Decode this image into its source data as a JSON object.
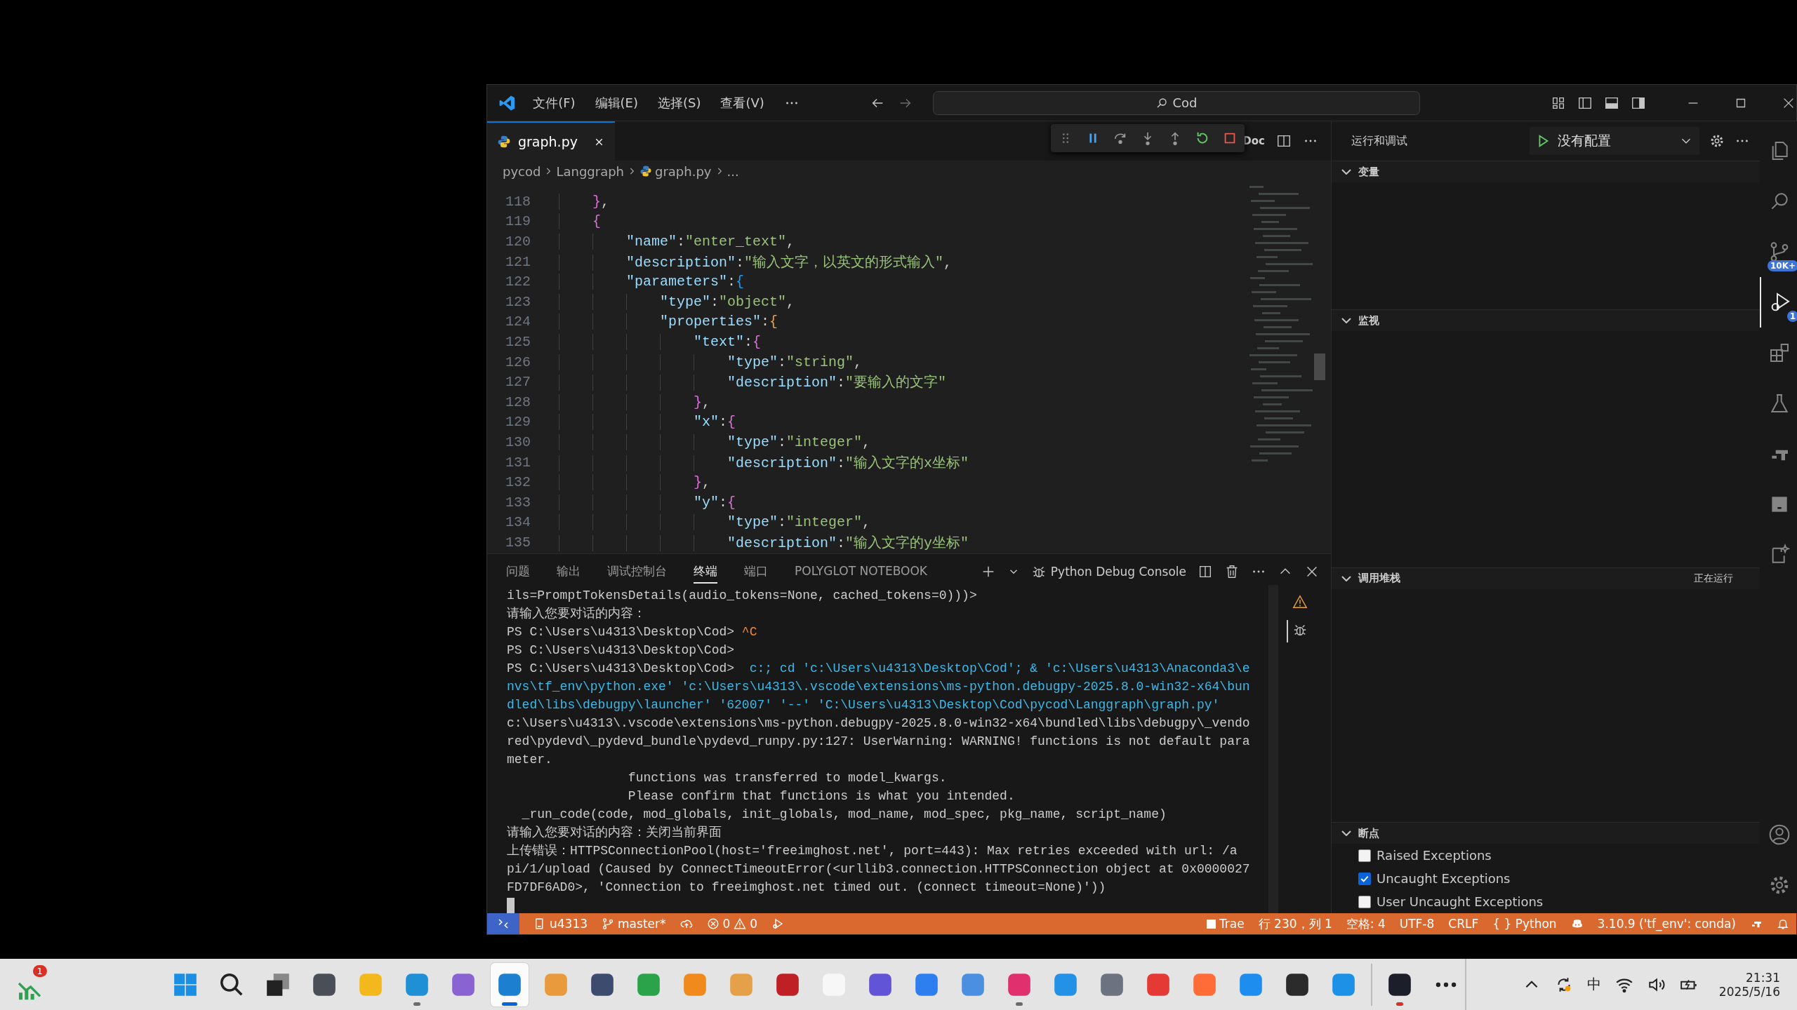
{
  "title_bar": {
    "menu": [
      "文件(F)",
      "编辑(E)",
      "选择(S)",
      "查看(V)"
    ],
    "search": {
      "value": "Cod"
    }
  },
  "editor_tabs": [
    {
      "label": "graph.py",
      "selected": true
    }
  ],
  "editor_actions": {
    "label": "Doc"
  },
  "breadcrumbs": [
    "pycod",
    "Langgraph",
    "graph.py",
    "..."
  ],
  "editor": {
    "lines": [
      {
        "number": "118",
        "tokens": [
          {
            "text": "    }",
            "kind": "b1"
          },
          {
            "text": ",",
            "kind": "punct"
          }
        ]
      },
      {
        "number": "119",
        "tokens": [
          {
            "text": "    {",
            "kind": "b1"
          }
        ]
      },
      {
        "number": "120",
        "tokens": [
          {
            "text": "        \"name\"",
            "kind": "key"
          },
          {
            "text": ":",
            "kind": "punct"
          },
          {
            "text": "\"enter_text\"",
            "kind": "string"
          },
          {
            "text": ",",
            "kind": "punct"
          }
        ]
      },
      {
        "number": "121",
        "tokens": [
          {
            "text": "        \"description\"",
            "kind": "key"
          },
          {
            "text": ":",
            "kind": "punct"
          },
          {
            "text": "\"输入文字，以英文的形式输入\"",
            "kind": "string"
          },
          {
            "text": ",",
            "kind": "punct"
          }
        ]
      },
      {
        "number": "122",
        "tokens": [
          {
            "text": "        \"parameters\"",
            "kind": "key"
          },
          {
            "text": ":",
            "kind": "punct"
          },
          {
            "text": "{",
            "kind": "b2"
          }
        ]
      },
      {
        "number": "123",
        "tokens": [
          {
            "text": "            \"type\"",
            "kind": "key"
          },
          {
            "text": ":",
            "kind": "punct"
          },
          {
            "text": "\"object\"",
            "kind": "string"
          },
          {
            "text": ",",
            "kind": "punct"
          }
        ]
      },
      {
        "number": "124",
        "tokens": [
          {
            "text": "            \"properties\"",
            "kind": "key"
          },
          {
            "text": ":",
            "kind": "punct"
          },
          {
            "text": "{",
            "kind": "b3"
          }
        ]
      },
      {
        "number": "125",
        "tokens": [
          {
            "text": "                \"text\"",
            "kind": "key"
          },
          {
            "text": ":",
            "kind": "punct"
          },
          {
            "text": "{",
            "kind": "b1"
          }
        ]
      },
      {
        "number": "126",
        "tokens": [
          {
            "text": "                    \"type\"",
            "kind": "key"
          },
          {
            "text": ":",
            "kind": "punct"
          },
          {
            "text": "\"string\"",
            "kind": "string"
          },
          {
            "text": ",",
            "kind": "punct"
          }
        ]
      },
      {
        "number": "127",
        "tokens": [
          {
            "text": "                    \"description\"",
            "kind": "key"
          },
          {
            "text": ":",
            "kind": "punct"
          },
          {
            "text": "\"要输入的文字\"",
            "kind": "string"
          }
        ]
      },
      {
        "number": "128",
        "tokens": [
          {
            "text": "                }",
            "kind": "b1"
          },
          {
            "text": ",",
            "kind": "punct"
          }
        ]
      },
      {
        "number": "129",
        "tokens": [
          {
            "text": "                \"x\"",
            "kind": "key"
          },
          {
            "text": ":",
            "kind": "punct"
          },
          {
            "text": "{",
            "kind": "b1"
          }
        ]
      },
      {
        "number": "130",
        "tokens": [
          {
            "text": "                    \"type\"",
            "kind": "key"
          },
          {
            "text": ":",
            "kind": "punct"
          },
          {
            "text": "\"integer\"",
            "kind": "string"
          },
          {
            "text": ",",
            "kind": "punct"
          }
        ]
      },
      {
        "number": "131",
        "tokens": [
          {
            "text": "                    \"description\"",
            "kind": "key"
          },
          {
            "text": ":",
            "kind": "punct"
          },
          {
            "text": "\"输入文字的x坐标\"",
            "kind": "string"
          }
        ]
      },
      {
        "number": "132",
        "tokens": [
          {
            "text": "                }",
            "kind": "b1"
          },
          {
            "text": ",",
            "kind": "punct"
          }
        ]
      },
      {
        "number": "133",
        "tokens": [
          {
            "text": "                \"y\"",
            "kind": "key"
          },
          {
            "text": ":",
            "kind": "punct"
          },
          {
            "text": "{",
            "kind": "b1"
          }
        ]
      },
      {
        "number": "134",
        "tokens": [
          {
            "text": "                    \"type\"",
            "kind": "key"
          },
          {
            "text": ":",
            "kind": "punct"
          },
          {
            "text": "\"integer\"",
            "kind": "string"
          },
          {
            "text": ",",
            "kind": "punct"
          }
        ]
      },
      {
        "number": "135",
        "tokens": [
          {
            "text": "                    \"description\"",
            "kind": "key"
          },
          {
            "text": ":",
            "kind": "punct"
          },
          {
            "text": "\"输入文字的y坐标\"",
            "kind": "string"
          }
        ]
      }
    ]
  },
  "panel": {
    "tabs": [
      {
        "label": "问题",
        "selected": false
      },
      {
        "label": "输出",
        "selected": false
      },
      {
        "label": "调试控制台",
        "selected": false
      },
      {
        "label": "终端",
        "selected": true
      },
      {
        "label": "端口",
        "selected": false
      },
      {
        "label": "POLYGLOT NOTEBOOK",
        "selected": false
      }
    ],
    "terminal_name": "Python Debug Console",
    "terminal_list": [
      {
        "kind": "warning",
        "selected": false
      },
      {
        "kind": "debug",
        "selected": true
      }
    ],
    "lines": [
      [
        {
          "text": "ils=PromptTokensDetails(audio_tokens=None, cached_tokens=0)))>",
          "kind": "out"
        }
      ],
      [
        {
          "text": "请输入您要对话的内容：",
          "kind": "out"
        }
      ],
      [
        {
          "text": "PS C:\\Users\\u4313\\Desktop\\Cod> ",
          "kind": "out"
        },
        {
          "text": "^C",
          "kind": "ctrl"
        }
      ],
      [
        {
          "text": "PS C:\\Users\\u4313\\Desktop\\Cod>",
          "kind": "out"
        }
      ],
      [
        {
          "text": "PS C:\\Users\\u4313\\Desktop\\Cod> ",
          "kind": "out"
        },
        {
          "text": " c:; cd 'c:\\Users\\u4313\\Desktop\\Cod'; & 'c:\\Users\\u4313\\Anaconda3\\e",
          "kind": "cmd"
        }
      ],
      [
        {
          "text": "nvs\\tf_env\\python.exe' 'c:\\Users\\u4313\\.vscode\\extensions\\ms-python.debugpy-2025.8.0-win32-x64\\bun",
          "kind": "cmd"
        }
      ],
      [
        {
          "text": "dled\\libs\\debugpy\\launcher' '62007' '--' 'C:\\Users\\u4313\\Desktop\\Cod\\pycod\\Langgraph\\graph.py'",
          "kind": "cmd"
        }
      ],
      [
        {
          "text": "c:\\Users\\u4313\\.vscode\\extensions\\ms-python.debugpy-2025.8.0-win32-x64\\bundled\\libs\\debugpy\\_vendo",
          "kind": "out"
        }
      ],
      [
        {
          "text": "red\\pydevd\\_pydevd_bundle\\pydevd_runpy.py:127: UserWarning: WARNING! functions is not default para",
          "kind": "out"
        }
      ],
      [
        {
          "text": "meter.",
          "kind": "out"
        }
      ],
      [
        {
          "text": "                functions was transferred to model_kwargs.",
          "kind": "out"
        }
      ],
      [
        {
          "text": "                Please confirm that functions is what you intended.",
          "kind": "out"
        }
      ],
      [
        {
          "text": "  _run_code(code, mod_globals, init_globals, mod_name, mod_spec, pkg_name, script_name)",
          "kind": "out"
        }
      ],
      [
        {
          "text": "请输入您要对话的内容：关闭当前界面",
          "kind": "out"
        }
      ],
      [
        {
          "text": "上传错误：HTTPSConnectionPool(host='freeimghost.net', port=443): Max retries exceeded with url: /a",
          "kind": "out"
        }
      ],
      [
        {
          "text": "pi/1/upload (Caused by ConnectTimeoutError(<urllib3.connection.HTTPSConnection object at 0x0000027",
          "kind": "out"
        }
      ],
      [
        {
          "text": "FD7DF6AD0>, 'Connection to freeimghost.net timed out. (connect timeout=None)'))",
          "kind": "out"
        }
      ]
    ]
  },
  "sidebar": {
    "title": "运行和调试",
    "config": "没有配置",
    "sections": [
      {
        "title": "变量",
        "expanded": true
      },
      {
        "title": "监视",
        "expanded": true
      },
      {
        "title": "调用堆栈",
        "expanded": true,
        "status": "正在运行"
      },
      {
        "title": "断点",
        "expanded": true
      }
    ],
    "breakpoints": [
      {
        "label": "Raised Exceptions",
        "checked": false
      },
      {
        "label": "Uncaught Exceptions",
        "checked": true
      },
      {
        "label": "User Uncaught Exceptions",
        "checked": false
      }
    ]
  },
  "activity_bar": {
    "top": [
      {
        "kind": "explorer",
        "selected": false
      },
      {
        "kind": "search",
        "selected": false
      },
      {
        "kind": "scm",
        "selected": false,
        "badge": "10K+"
      },
      {
        "kind": "debug",
        "selected": true,
        "badge": "1"
      },
      {
        "kind": "extensions",
        "selected": false
      },
      {
        "kind": "testing",
        "selected": false
      },
      {
        "kind": "remote",
        "selected": false
      },
      {
        "kind": "panel",
        "selected": false
      },
      {
        "kind": "copilot",
        "selected": false
      }
    ],
    "bottom": [
      {
        "kind": "account",
        "selected": false
      },
      {
        "kind": "settings",
        "selected": false
      }
    ]
  },
  "status_bar": {
    "left": [
      {
        "kind": "remote"
      },
      {
        "kind": "folder",
        "text": "u4313"
      },
      {
        "kind": "branch",
        "text": "master*"
      },
      {
        "kind": "sync"
      },
      {
        "kind": "problems",
        "errors": "0",
        "warnings": "0"
      },
      {
        "kind": "debug"
      }
    ],
    "right": [
      {
        "kind": "square",
        "text": "Trae"
      },
      {
        "kind": "text",
        "text": "行 230，列 1"
      },
      {
        "kind": "text",
        "text": "空格: 4"
      },
      {
        "kind": "text",
        "text": "UTF-8"
      },
      {
        "kind": "text",
        "text": "CRLF"
      },
      {
        "kind": "language",
        "glyph": "{ }",
        "text": "Python"
      },
      {
        "kind": "copilot"
      },
      {
        "kind": "text",
        "text": "3.10.9 ('tf_env': conda)"
      },
      {
        "kind": "ports"
      },
      {
        "kind": "bell"
      }
    ]
  },
  "taskbar": {
    "widget": {
      "badge": "1"
    },
    "apps": [
      {
        "kind": "windows",
        "running": false,
        "selected": false
      },
      {
        "kind": "search",
        "running": false,
        "selected": false
      },
      {
        "kind": "taskview",
        "running": false,
        "selected": false
      },
      {
        "kind": "app",
        "color": "#4a4f57",
        "running": false,
        "selected": false
      },
      {
        "kind": "app",
        "color": "#f2b81c",
        "running": false,
        "selected": false
      },
      {
        "kind": "app",
        "color": "#1f8fd6",
        "running": true,
        "selected": false
      },
      {
        "kind": "app",
        "color": "#8a63d2",
        "running": false,
        "selected": false
      },
      {
        "kind": "app",
        "color": "#1c7fd0",
        "running": true,
        "selected": true
      },
      {
        "kind": "app",
        "color": "#e99a3c",
        "running": false,
        "selected": false
      },
      {
        "kind": "app",
        "color": "#3d4b6e",
        "running": false,
        "selected": false
      },
      {
        "kind": "app",
        "color": "#2ba34a",
        "running": false,
        "selected": false
      },
      {
        "kind": "app",
        "color": "#f08a1c",
        "running": false,
        "selected": false
      },
      {
        "kind": "app",
        "color": "#e5a14a",
        "running": false,
        "selected": false
      },
      {
        "kind": "app",
        "color": "#bf2026",
        "running": false,
        "selected": false
      },
      {
        "kind": "app",
        "color": "#f7f7f7",
        "running": false,
        "selected": false
      },
      {
        "kind": "app",
        "color": "#6154d6",
        "running": false,
        "selected": false
      },
      {
        "kind": "app",
        "color": "#2d7ff0",
        "running": false,
        "selected": false
      },
      {
        "kind": "app",
        "color": "#4b8fe0",
        "running": false,
        "selected": false
      },
      {
        "kind": "app",
        "color": "#e0306e",
        "running": true,
        "selected": false
      },
      {
        "kind": "app",
        "color": "#2391e6",
        "running": false,
        "selected": false
      },
      {
        "kind": "app",
        "color": "#6c7280",
        "running": false,
        "selected": false
      },
      {
        "kind": "app",
        "color": "#e53935",
        "running": false,
        "selected": false
      },
      {
        "kind": "app",
        "color": "#ff6c37",
        "running": false,
        "selected": false
      },
      {
        "kind": "app",
        "color": "#1d8ef0",
        "running": false,
        "selected": false
      },
      {
        "kind": "app",
        "color": "#2b2b2b",
        "running": false,
        "selected": false
      },
      {
        "kind": "app",
        "color": "#1d91e6",
        "running": false,
        "selected": false
      },
      {
        "kind": "separator"
      },
      {
        "kind": "app",
        "color": "#1c1f2a",
        "running": true,
        "selected": false,
        "attention": true
      }
    ],
    "tray": {
      "ime": "中",
      "time": "21:31",
      "date": "2025/5/16"
    }
  }
}
